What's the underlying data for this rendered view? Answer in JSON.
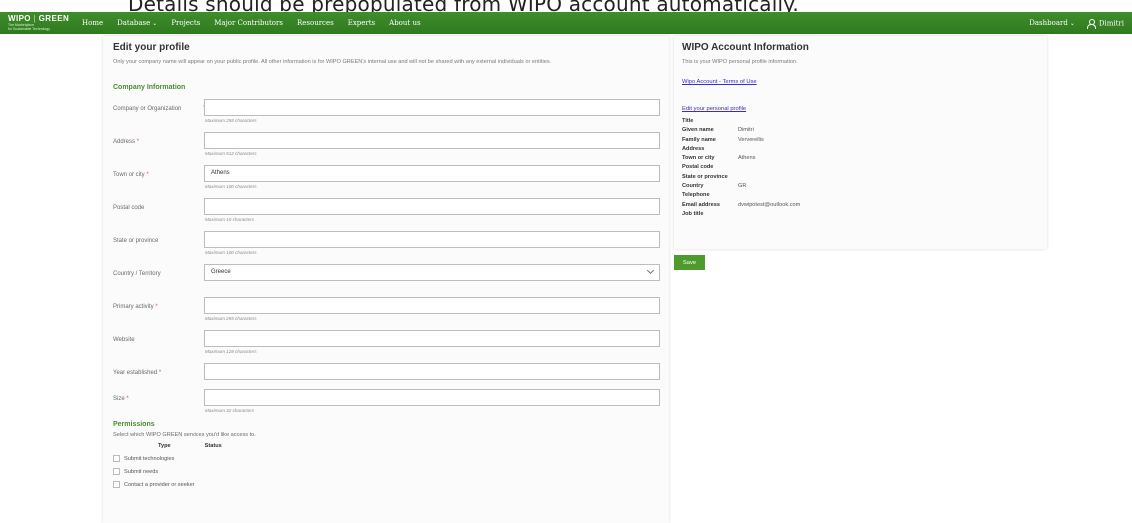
{
  "caption": "Details should be prepopulated from WIPO account automatically.",
  "navbar": {
    "logo_main": "WIPO",
    "logo_bar": "|",
    "logo_green": "GREEN",
    "logo_sub1": "The Marketplace",
    "logo_sub2": "for Sustainable Technology",
    "items": [
      "Home",
      "Database",
      "Projects",
      "Major Contributors",
      "Resources",
      "Experts",
      "About us"
    ],
    "dashboard": "Dashboard",
    "user": "Dimitri"
  },
  "profile": {
    "title": "Edit your profile",
    "description": "Only your company name will appear on your public profile. All other information is for WIPO GREEN's internal use and will not be shared with any external individuals or entities.",
    "company_section": "Company Information",
    "fields": {
      "company": {
        "label": "Company or Organization",
        "value": "",
        "hint": "Maximum 255 characters"
      },
      "address": {
        "label": "Address",
        "value": "",
        "hint": "Maximum 512 characters"
      },
      "town": {
        "label": "Town or city",
        "value": "Athens",
        "hint": "Maximum 100 characters"
      },
      "postal": {
        "label": "Postal code",
        "value": "",
        "hint": "Maximum 10 characters"
      },
      "state": {
        "label": "State or province",
        "value": "",
        "hint": "Maximum 100 characters"
      },
      "country": {
        "label": "Country / Territory",
        "value": "Greece"
      },
      "activity": {
        "label": "Primary activity",
        "value": "",
        "hint": "Maximum 255 characters"
      },
      "website": {
        "label": "Website",
        "value": "",
        "hint": "Maximum 128 characters"
      },
      "year": {
        "label": "Year established",
        "value": ""
      },
      "size": {
        "label": "Size",
        "value": "",
        "hint": "Maximum 32 characters"
      }
    },
    "required_mark": "*"
  },
  "permissions": {
    "title": "Permissions",
    "description": "Select which WIPO GREEN services you'd like access to.",
    "col_type": "Type",
    "col_status": "Status",
    "items": [
      "Submit technologies",
      "Submit needs",
      "Contact a provider or seeker"
    ]
  },
  "account": {
    "title": "WIPO Account Information",
    "subtitle": "This is your WIPO personal profile information.",
    "terms_link": "Wipo Account - Terms of Use",
    "edit_link": "Edit your personal profile",
    "rows": [
      {
        "k": "Title",
        "v": ""
      },
      {
        "k": "Given name",
        "v": "Dimitri"
      },
      {
        "k": "Family name",
        "v": "Ververellis"
      },
      {
        "k": "Address",
        "v": ""
      },
      {
        "k": "Town or city",
        "v": "Athens"
      },
      {
        "k": "Postal code",
        "v": ""
      },
      {
        "k": "State or province",
        "v": ""
      },
      {
        "k": "Country",
        "v": "GR"
      },
      {
        "k": "Telephone",
        "v": ""
      },
      {
        "k": "Email address",
        "v": "dvwipotest@outlook.com"
      },
      {
        "k": "Job title",
        "v": ""
      }
    ]
  },
  "save_label": "Save",
  "colors": {
    "nav": "#3a8528",
    "accent": "#4a8c35",
    "button": "#4e9a2c",
    "link": "#3b2bcc",
    "required": "#d9534f"
  },
  "icons": {
    "user": "user-icon",
    "dropdown": "chevron-down-icon"
  }
}
